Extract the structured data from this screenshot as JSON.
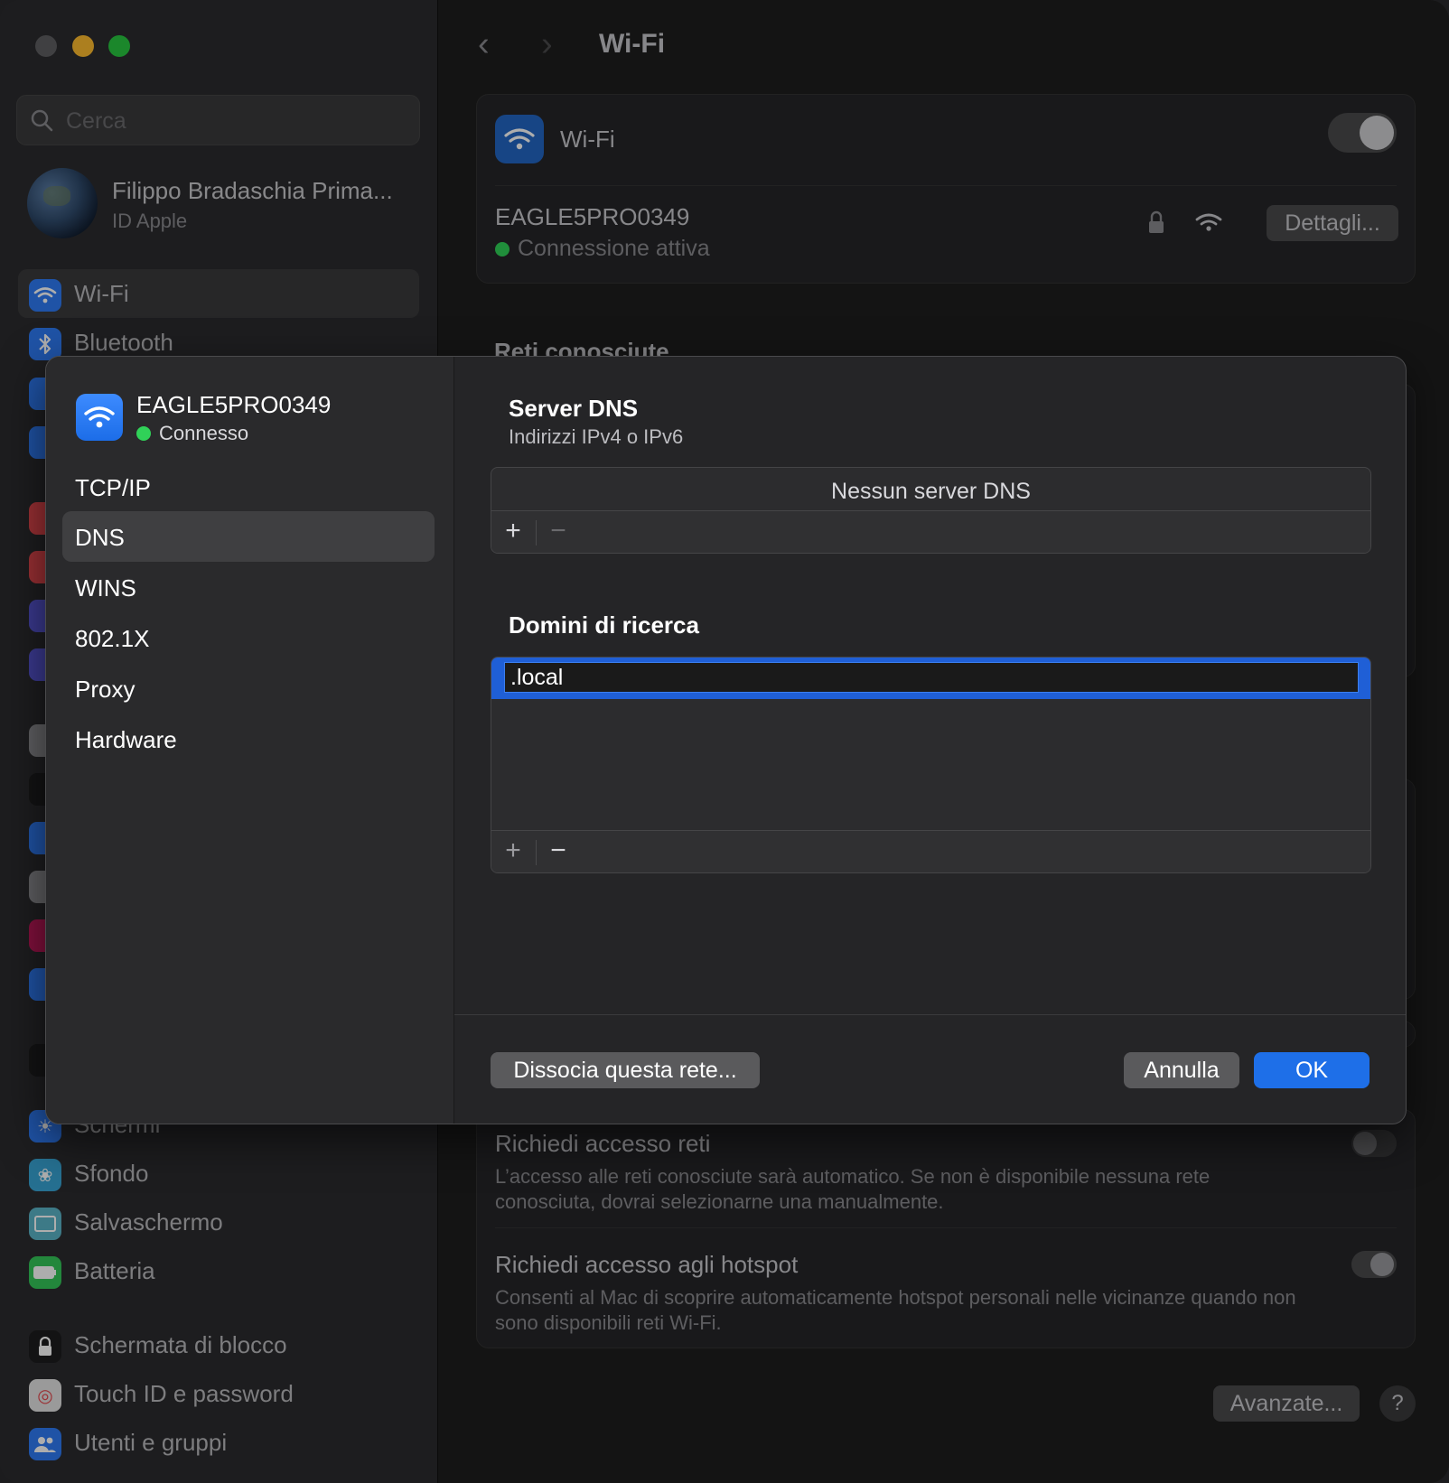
{
  "sidebar": {
    "search_placeholder": "Cerca",
    "profile": {
      "name": "Filippo Bradaschia Prima...",
      "subtitle": "ID Apple"
    },
    "items": [
      {
        "label": "Wi-Fi",
        "icon": "wifi-icon",
        "color": "#2f7bf5",
        "active": true
      },
      {
        "label": "Bluetooth",
        "icon": "bluetooth-icon",
        "color": "#2f7bf5"
      },
      {
        "label": "Schermi",
        "icon": "display-icon",
        "color": "#2f7bf5"
      },
      {
        "label": "Sfondo",
        "icon": "wallpaper-icon",
        "color": "#39a6d6"
      },
      {
        "label": "Salvaschermo",
        "icon": "screensaver-icon",
        "color": "#5ab4c8"
      },
      {
        "label": "Batteria",
        "icon": "battery-icon",
        "color": "#34c759"
      },
      {
        "label": "Schermata di blocco",
        "icon": "lock-icon",
        "color": "#1c1c1e"
      },
      {
        "label": "Touch ID e password",
        "icon": "fingerprint-icon",
        "color": "#e3e3e3"
      },
      {
        "label": "Utenti e gruppi",
        "icon": "users-icon",
        "color": "#2f7bf5"
      }
    ]
  },
  "main": {
    "title": "Wi-Fi",
    "wifi_label": "Wi-Fi",
    "network": {
      "name": "EAGLE5PRO0349",
      "status": "Connessione attiva",
      "details_button": "Dettagli..."
    },
    "known_networks_heading": "Reti conosciute",
    "ask_networks": {
      "title": "Richiedi accesso reti",
      "description": "L’accesso alle reti conosciute sarà automatico. Se non è disponibile nessuna rete conosciuta, dovrai selezionarne una manualmente."
    },
    "ask_hotspots": {
      "title": "Richiedi accesso agli hotspot",
      "description": "Consenti al Mac di scoprire automaticamente hotspot personali nelle vicinanze quando non sono disponibili reti Wi-Fi."
    },
    "advanced_button": "Avanzate...",
    "help_button": "?"
  },
  "sheet": {
    "network_name": "EAGLE5PRO0349",
    "network_status": "Connesso",
    "nav": [
      "TCP/IP",
      "DNS",
      "WINS",
      "802.1X",
      "Proxy",
      "Hardware"
    ],
    "active_nav": "DNS",
    "dns": {
      "title": "Server DNS",
      "subtitle": "Indirizzi IPv4 o IPv6",
      "empty_text": "Nessun server DNS"
    },
    "search_domains": {
      "title": "Domini di ricerca",
      "editing_value": ".local"
    },
    "add_symbol": "+",
    "remove_symbol": "−",
    "forget_button": "Dissocia questa rete...",
    "cancel_button": "Annulla",
    "ok_button": "OK",
    "accent_color": "#1e6fe8"
  }
}
